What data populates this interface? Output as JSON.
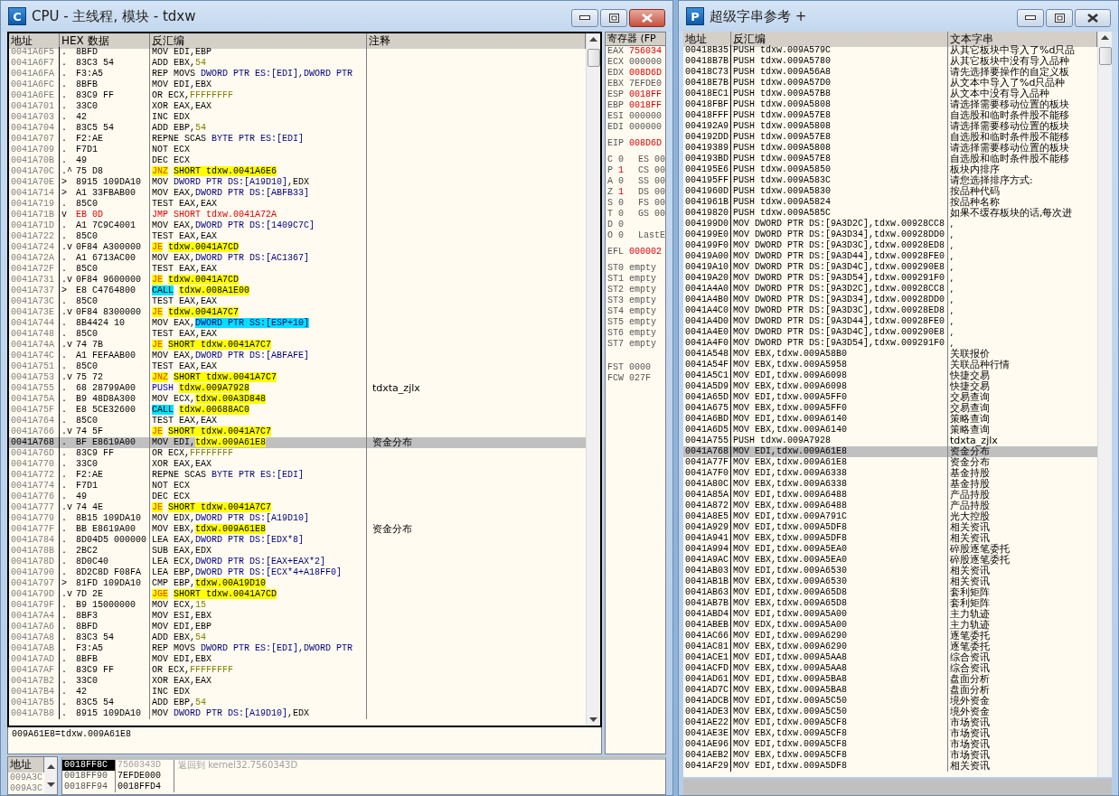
{
  "cpu_window": {
    "title": "CPU - 主线程, 模块 - tdxw",
    "icon_letter": "C",
    "disassembly": {
      "columns": [
        "地址",
        "HEX 数据",
        "反汇编",
        "注释"
      ],
      "rows": [
        {
          "address": "0041A6F5",
          "marker": ".",
          "hex": "8BFD",
          "mnemonic": {
            "text": "MOV",
            "kind": "plain"
          },
          "operands": "EDI,EBP",
          "selected": false
        },
        {
          "address": "0041A6F7",
          "marker": ".",
          "hex": "83C3 54",
          "mnemonic": {
            "text": "ADD",
            "kind": "plain"
          },
          "operands": "EBX,",
          "target": {
            "text": "54",
            "kind": "const"
          },
          "selected": false
        },
        {
          "address": "0041A6FA",
          "marker": ".",
          "hex": "F3:A5",
          "mnemonic": {
            "text": "REP MOVS",
            "kind": "plain"
          },
          "target": {
            "text": "DWORD PTR ES:[EDI],DWORD PTR",
            "kind": "mem"
          },
          "selected": false
        },
        {
          "address": "0041A6FC",
          "marker": ".",
          "hex": "8BFB",
          "mnemonic": {
            "text": "MOV",
            "kind": "plain"
          },
          "operands": "EDI,EBX",
          "selected": false
        },
        {
          "address": "0041A6FE",
          "marker": ".",
          "hex": "83C9 FF",
          "mnemonic": {
            "text": "OR",
            "kind": "plain"
          },
          "operands": "ECX,",
          "target": {
            "text": "FFFFFFFF",
            "kind": "const"
          },
          "selected": false
        },
        {
          "address": "0041A701",
          "marker": ".",
          "hex": "33C0",
          "mnemonic": {
            "text": "XOR",
            "kind": "plain"
          },
          "operands": "EAX,EAX",
          "selected": false
        },
        {
          "address": "0041A703",
          "marker": ".",
          "hex": "42",
          "mnemonic": {
            "text": "INC",
            "kind": "plain"
          },
          "operands": "EDX",
          "selected": false
        },
        {
          "address": "0041A704",
          "marker": ".",
          "hex": "83C5 54",
          "mnemonic": {
            "text": "ADD",
            "kind": "plain"
          },
          "operands": "EBP,",
          "target": {
            "text": "54",
            "kind": "const"
          },
          "selected": false
        },
        {
          "address": "0041A707",
          "marker": ".",
          "hex": "F2:AE",
          "mnemonic": {
            "text": "REPNE SCAS",
            "kind": "plain"
          },
          "target": {
            "text": "BYTE PTR ES:[EDI]",
            "kind": "mem"
          },
          "selected": false
        },
        {
          "address": "0041A709",
          "marker": ".",
          "hex": "F7D1",
          "mnemonic": {
            "text": "NOT",
            "kind": "plain"
          },
          "operands": "ECX",
          "selected": false
        },
        {
          "address": "0041A70B",
          "marker": ".",
          "hex": "49",
          "mnemonic": {
            "text": "DEC",
            "kind": "plain"
          },
          "operands": "ECX",
          "selected": false
        },
        {
          "address": "0041A70C",
          "marker": ".^",
          "hex": "75 D8",
          "mnemonic": {
            "text": "JNZ",
            "kind": "cond_jump"
          },
          "target": {
            "text": "SHORT tdxw.0041A6E6",
            "kind": "addr"
          },
          "selected": false
        },
        {
          "address": "0041A70E",
          "marker": ">",
          "hex": "8915 109DA10",
          "mnemonic": {
            "text": "MOV",
            "kind": "plain"
          },
          "target": {
            "text": "DWORD PTR DS:[A19D10]",
            "kind": "mem"
          },
          "tail": ",EDX",
          "selected": false
        },
        {
          "address": "0041A714",
          "marker": ">",
          "hex": "A1 33FBAB00",
          "mnemonic": {
            "text": "MOV",
            "kind": "plain"
          },
          "operands": "EAX,",
          "target": {
            "text": "DWORD PTR DS:[ABFB33]",
            "kind": "mem"
          },
          "selected": false
        },
        {
          "address": "0041A719",
          "marker": ".",
          "hex": "85C0",
          "mnemonic": {
            "text": "TEST",
            "kind": "plain"
          },
          "operands": "EAX,EAX",
          "selected": false
        },
        {
          "address": "0041A71B",
          "marker": "v",
          "hex": "EB 0D",
          "mnemonic": {
            "text": "JMP",
            "kind": "jump"
          },
          "target": {
            "text": "SHORT tdxw.0041A72A",
            "kind": "red"
          },
          "selected": false
        },
        {
          "address": "0041A71D",
          "marker": ".",
          "hex": "A1 7C9C4001",
          "mnemonic": {
            "text": "MOV",
            "kind": "plain"
          },
          "operands": "EAX,",
          "target": {
            "text": "DWORD PTR DS:[1409C7C]",
            "kind": "mem"
          },
          "selected": false
        },
        {
          "address": "0041A722",
          "marker": ".",
          "hex": "85C0",
          "mnemonic": {
            "text": "TEST",
            "kind": "plain"
          },
          "operands": "EAX,EAX",
          "selected": false
        },
        {
          "address": "0041A724",
          "marker": ".v",
          "hex": "0F84 A300000",
          "mnemonic": {
            "text": "JE",
            "kind": "cond_jump"
          },
          "target": {
            "text": "tdxw.0041A7CD",
            "kind": "addr"
          },
          "selected": false
        },
        {
          "address": "0041A72A",
          "marker": ".",
          "hex": "A1 6713AC00",
          "mnemonic": {
            "text": "MOV",
            "kind": "plain"
          },
          "operands": "EAX,",
          "target": {
            "text": "DWORD PTR DS:[AC1367]",
            "kind": "mem"
          },
          "selected": false
        },
        {
          "address": "0041A72F",
          "marker": ".",
          "hex": "85C0",
          "mnemonic": {
            "text": "TEST",
            "kind": "plain"
          },
          "operands": "EAX,EAX",
          "selected": false
        },
        {
          "address": "0041A731",
          "marker": ".v",
          "hex": "0F84 9600000",
          "mnemonic": {
            "text": "JE",
            "kind": "cond_jump"
          },
          "target": {
            "text": "tdxw.0041A7CD",
            "kind": "addr"
          },
          "selected": false
        },
        {
          "address": "0041A737",
          "marker": ">",
          "hex": "E8 C4764800",
          "mnemonic": {
            "text": "CALL",
            "kind": "call"
          },
          "target": {
            "text": "tdxw.008A1E00",
            "kind": "addr"
          },
          "selected": false
        },
        {
          "address": "0041A73C",
          "marker": ".",
          "hex": "85C0",
          "mnemonic": {
            "text": "TEST",
            "kind": "plain"
          },
          "operands": "EAX,EAX",
          "selected": false
        },
        {
          "address": "0041A73E",
          "marker": ".v",
          "hex": "0F84 8300000",
          "mnemonic": {
            "text": "JE",
            "kind": "cond_jump"
          },
          "target": {
            "text": "tdxw.0041A7C7",
            "kind": "addr"
          },
          "selected": false
        },
        {
          "address": "0041A744",
          "marker": ".",
          "hex": "8B4424 10",
          "mnemonic": {
            "text": "MOV",
            "kind": "plain"
          },
          "operands": "EAX,",
          "target": {
            "text": "DWORD PTR SS:[ESP+10]",
            "kind": "stack"
          },
          "selected": false
        },
        {
          "address": "0041A748",
          "marker": ".",
          "hex": "85C0",
          "mnemonic": {
            "text": "TEST",
            "kind": "plain"
          },
          "operands": "EAX,EAX",
          "selected": false
        },
        {
          "address": "0041A74A",
          "marker": ".v",
          "hex": "74 7B",
          "mnemonic": {
            "text": "JE",
            "kind": "cond_jump"
          },
          "target": {
            "text": "SHORT tdxw.0041A7C7",
            "kind": "addr"
          },
          "selected": false
        },
        {
          "address": "0041A74C",
          "marker": ".",
          "hex": "A1 FEFAAB00",
          "mnemonic": {
            "text": "MOV",
            "kind": "plain"
          },
          "operands": "EAX,",
          "target": {
            "text": "DWORD PTR DS:[ABFAFE]",
            "kind": "mem"
          },
          "selected": false
        },
        {
          "address": "0041A751",
          "marker": ".",
          "hex": "85C0",
          "mnemonic": {
            "text": "TEST",
            "kind": "plain"
          },
          "operands": "EAX,EAX",
          "selected": false
        },
        {
          "address": "0041A753",
          "marker": ".v",
          "hex": "75 72",
          "mnemonic": {
            "text": "JNZ",
            "kind": "cond_jump"
          },
          "target": {
            "text": "SHORT tdxw.0041A7C7",
            "kind": "addr"
          },
          "selected": false
        },
        {
          "address": "0041A755",
          "marker": ".",
          "hex": "68 28799A00",
          "mnemonic": {
            "text": "PUSH",
            "kind": "push"
          },
          "target": {
            "text": "tdxw.009A7928",
            "kind": "addr"
          },
          "comment": "tdxta_zjlx",
          "selected": false
        },
        {
          "address": "0041A75A",
          "marker": ".",
          "hex": "B9 48D8A300",
          "mnemonic": {
            "text": "MOV",
            "kind": "plain"
          },
          "operands": "ECX,",
          "target": {
            "text": "tdxw.00A3D848",
            "kind": "addr"
          },
          "selected": false
        },
        {
          "address": "0041A75F",
          "marker": ".",
          "hex": "E8 5CE32600",
          "mnemonic": {
            "text": "CALL",
            "kind": "call"
          },
          "target": {
            "text": "tdxw.00688AC0",
            "kind": "addr"
          },
          "selected": false
        },
        {
          "address": "0041A764",
          "marker": ".",
          "hex": "85C0",
          "mnemonic": {
            "text": "TEST",
            "kind": "plain"
          },
          "operands": "EAX,EAX",
          "selected": false
        },
        {
          "address": "0041A766",
          "marker": ".v",
          "hex": "74 5F",
          "mnemonic": {
            "text": "JE",
            "kind": "cond_jump"
          },
          "target": {
            "text": "SHORT tdxw.0041A7C7",
            "kind": "addr"
          },
          "selected": false
        },
        {
          "address": "0041A768",
          "marker": ".",
          "hex": "BF E8619A00",
          "mnemonic": {
            "text": "MOV",
            "kind": "plain"
          },
          "operands": "EDI,",
          "target": {
            "text": "tdxw.009A61E8",
            "kind": "addr"
          },
          "comment": "资金分布",
          "selected": true
        },
        {
          "address": "0041A76D",
          "marker": ".",
          "hex": "83C9 FF",
          "mnemonic": {
            "text": "OR",
            "kind": "plain"
          },
          "operands": "ECX,",
          "target": {
            "text": "FFFFFFFF",
            "kind": "const"
          },
          "selected": false
        },
        {
          "address": "0041A770",
          "marker": ".",
          "hex": "33C0",
          "mnemonic": {
            "text": "XOR",
            "kind": "plain"
          },
          "operands": "EAX,EAX",
          "selected": false
        },
        {
          "address": "0041A772",
          "marker": ".",
          "hex": "F2:AE",
          "mnemonic": {
            "text": "REPNE SCAS",
            "kind": "plain"
          },
          "target": {
            "text": "BYTE PTR ES:[EDI]",
            "kind": "mem"
          },
          "selected": false
        },
        {
          "address": "0041A774",
          "marker": ".",
          "hex": "F7D1",
          "mnemonic": {
            "text": "NOT",
            "kind": "plain"
          },
          "operands": "ECX",
          "selected": false
        },
        {
          "address": "0041A776",
          "marker": ".",
          "hex": "49",
          "mnemonic": {
            "text": "DEC",
            "kind": "plain"
          },
          "operands": "ECX",
          "selected": false
        },
        {
          "address": "0041A777",
          "marker": ".v",
          "hex": "74 4E",
          "mnemonic": {
            "text": "JE",
            "kind": "cond_jump"
          },
          "target": {
            "text": "SHORT tdxw.0041A7C7",
            "kind": "addr"
          },
          "selected": false
        },
        {
          "address": "0041A779",
          "marker": ".",
          "hex": "8B15 109DA10",
          "mnemonic": {
            "text": "MOV",
            "kind": "plain"
          },
          "operands": "EDX,",
          "target": {
            "text": "DWORD PTR DS:[A19D10]",
            "kind": "mem"
          },
          "selected": false
        },
        {
          "address": "0041A77F",
          "marker": ".",
          "hex": "BB E8619A00",
          "mnemonic": {
            "text": "MOV",
            "kind": "plain"
          },
          "operands": "EBX,",
          "target": {
            "text": "tdxw.009A61E8",
            "kind": "addr"
          },
          "comment": "资金分布",
          "selected": false
        },
        {
          "address": "0041A784",
          "marker": ".",
          "hex": "8D04D5 000000",
          "mnemonic": {
            "text": "LEA",
            "kind": "plain"
          },
          "operands": "EAX,",
          "target": {
            "text": "DWORD PTR DS:[EDX*8]",
            "kind": "mem"
          },
          "selected": false
        },
        {
          "address": "0041A78B",
          "marker": ".",
          "hex": "2BC2",
          "mnemonic": {
            "text": "SUB",
            "kind": "plain"
          },
          "operands": "EAX,EDX",
          "selected": false
        },
        {
          "address": "0041A78D",
          "marker": ".",
          "hex": "8D0C40",
          "mnemonic": {
            "text": "LEA",
            "kind": "plain"
          },
          "operands": "ECX,",
          "target": {
            "text": "DWORD PTR DS:[EAX+EAX*2]",
            "kind": "mem"
          },
          "selected": false
        },
        {
          "address": "0041A790",
          "marker": ".",
          "hex": "8D2C8D F08FA",
          "mnemonic": {
            "text": "LEA",
            "kind": "plain"
          },
          "operands": "EBP,",
          "target": {
            "text": "DWORD PTR DS:[ECX*4+A18FF0]",
            "kind": "mem"
          },
          "selected": false
        },
        {
          "address": "0041A797",
          "marker": ">",
          "hex": "81FD 109DA10",
          "mnemonic": {
            "text": "CMP",
            "kind": "plain"
          },
          "operands": "EBP,",
          "target": {
            "text": "tdxw.00A19D10",
            "kind": "addr"
          },
          "selected": false
        },
        {
          "address": "0041A79D",
          "marker": ".v",
          "hex": "7D 2E",
          "mnemonic": {
            "text": "JGE",
            "kind": "cond_jump"
          },
          "target": {
            "text": "SHORT tdxw.0041A7CD",
            "kind": "addr"
          },
          "selected": false
        },
        {
          "address": "0041A79F",
          "marker": ".",
          "hex": "B9 15000000",
          "mnemonic": {
            "text": "MOV",
            "kind": "plain"
          },
          "operands": "ECX,",
          "target": {
            "text": "15",
            "kind": "const"
          },
          "selected": false
        },
        {
          "address": "0041A7A4",
          "marker": ".",
          "hex": "8BF3",
          "mnemonic": {
            "text": "MOV",
            "kind": "plain"
          },
          "operands": "ESI,EBX",
          "selected": false
        },
        {
          "address": "0041A7A6",
          "marker": ".",
          "hex": "8BFD",
          "mnemonic": {
            "text": "MOV",
            "kind": "plain"
          },
          "operands": "EDI,EBP",
          "selected": false
        },
        {
          "address": "0041A7A8",
          "marker": ".",
          "hex": "83C3 54",
          "mnemonic": {
            "text": "ADD",
            "kind": "plain"
          },
          "operands": "EBX,",
          "target": {
            "text": "54",
            "kind": "const"
          },
          "selected": false
        },
        {
          "address": "0041A7AB",
          "marker": ".",
          "hex": "F3:A5",
          "mnemonic": {
            "text": "REP MOVS",
            "kind": "plain"
          },
          "target": {
            "text": "DWORD PTR ES:[EDI],DWORD PTR",
            "kind": "mem"
          },
          "selected": false
        },
        {
          "address": "0041A7AD",
          "marker": ".",
          "hex": "8BFB",
          "mnemonic": {
            "text": "MOV",
            "kind": "plain"
          },
          "operands": "EDI,EBX",
          "selected": false
        },
        {
          "address": "0041A7AF",
          "marker": ".",
          "hex": "83C9 FF",
          "mnemonic": {
            "text": "OR",
            "kind": "plain"
          },
          "operands": "ECX,",
          "target": {
            "text": "FFFFFFFF",
            "kind": "const"
          },
          "selected": false
        },
        {
          "address": "0041A7B2",
          "marker": ".",
          "hex": "33C0",
          "mnemonic": {
            "text": "XOR",
            "kind": "plain"
          },
          "operands": "EAX,EAX",
          "selected": false
        },
        {
          "address": "0041A7B4",
          "marker": ".",
          "hex": "42",
          "mnemonic": {
            "text": "INC",
            "kind": "plain"
          },
          "operands": "EDX",
          "selected": false
        },
        {
          "address": "0041A7B5",
          "marker": ".",
          "hex": "83C5 54",
          "mnemonic": {
            "text": "ADD",
            "kind": "plain"
          },
          "operands": "EBP,",
          "target": {
            "text": "54",
            "kind": "const"
          },
          "selected": false
        },
        {
          "address": "0041A7B8",
          "marker": ".",
          "hex": "8915 109DA10",
          "mnemonic": {
            "text": "MOV",
            "kind": "plain"
          },
          "target": {
            "text": "DWORD PTR DS:[A19D10]",
            "kind": "mem"
          },
          "tail": ",EDX",
          "selected": false
        }
      ]
    },
    "registers": {
      "header": "寄存器 (FP",
      "registers": [
        {
          "name": "EAX",
          "value": "756034",
          "changed": true
        },
        {
          "name": "ECX",
          "value": "000000",
          "changed": false
        },
        {
          "name": "EDX",
          "value": "008D6D",
          "changed": true
        },
        {
          "name": "EBX",
          "value": "7EFDE0",
          "changed": false
        },
        {
          "name": "ESP",
          "value": "0018FF",
          "changed": true
        },
        {
          "name": "EBP",
          "value": "0018FF",
          "changed": true
        },
        {
          "name": "ESI",
          "value": "000000",
          "changed": false
        },
        {
          "name": "EDI",
          "value": "000000",
          "changed": false
        }
      ],
      "eip": {
        "name": "EIP",
        "value": "008D6D",
        "changed": true
      },
      "flags": [
        {
          "flag": "C",
          "value": "0",
          "changed": false,
          "right": "ES 00"
        },
        {
          "flag": "P",
          "value": "1",
          "changed": true,
          "right": "CS 00"
        },
        {
          "flag": "A",
          "value": "0",
          "changed": false,
          "right": "SS 00"
        },
        {
          "flag": "Z",
          "value": "1",
          "changed": true,
          "right": "DS 00"
        },
        {
          "flag": "S",
          "value": "0",
          "changed": false,
          "right": "FS 00"
        },
        {
          "flag": "T",
          "value": "0",
          "changed": false,
          "right": "GS 00"
        },
        {
          "flag": "D",
          "value": "0",
          "changed": false
        },
        {
          "flag": "O",
          "value": "0",
          "changed": false,
          "right": "LastE"
        }
      ],
      "efl": {
        "name": "EFL",
        "value": "000002",
        "changed": true
      },
      "fpu": [
        {
          "name": "ST0",
          "value": "empty"
        },
        {
          "name": "ST1",
          "value": "empty"
        },
        {
          "name": "ST2",
          "value": "empty"
        },
        {
          "name": "ST3",
          "value": "empty"
        },
        {
          "name": "ST4",
          "value": "empty"
        },
        {
          "name": "ST5",
          "value": "empty"
        },
        {
          "name": "ST6",
          "value": "empty"
        },
        {
          "name": "ST7",
          "value": "empty"
        }
      ],
      "fpu_control": [
        {
          "name": "FST",
          "value": "0000"
        },
        {
          "name": "FCW",
          "value": "027F"
        }
      ]
    },
    "info_line": "009A61E8=tdxw.009A61E8",
    "dump": {
      "column": "地址",
      "rows": [
        "009A3C",
        "009A3C"
      ]
    },
    "stack": {
      "rows": [
        {
          "address": "0018FF8C",
          "value": "7560343D",
          "comment": "返回到 kernel32.7560343D",
          "selected": true
        },
        {
          "address": "0018FF90",
          "value": "7EFDE000",
          "selected": false
        },
        {
          "address": "0018FF94",
          "value": "0018FFD4",
          "selected": false
        }
      ]
    }
  },
  "strings_window": {
    "title": "超级字串参考 +",
    "icon_letter": "P",
    "columns": [
      "地址",
      "反汇编",
      "文本字串"
    ],
    "rows": [
      {
        "address": "00418B35",
        "disassembly": "PUSH tdxw.009A579C",
        "text": "从其它板块中导入了%d只品",
        "selected": false
      },
      {
        "address": "00418B7B",
        "disassembly": "PUSH tdxw.009A5780",
        "text": "从其它板块中没有导入品种",
        "selected": false
      },
      {
        "address": "00418C73",
        "disassembly": "PUSH tdxw.009A56A8",
        "text": "请先选择要操作的自定义板",
        "selected": false
      },
      {
        "address": "00418E7B",
        "disassembly": "PUSH tdxw.009A57D0",
        "text": "从文本中导入了%d只品种",
        "selected": false
      },
      {
        "address": "00418EC1",
        "disassembly": "PUSH tdxw.009A57B8",
        "text": "从文本中没有导入品种",
        "selected": false
      },
      {
        "address": "00418FBF",
        "disassembly": "PUSH tdxw.009A5808",
        "text": "请选择需要移动位置的板块",
        "selected": false
      },
      {
        "address": "00418FFF",
        "disassembly": "PUSH tdxw.009A57E8",
        "text": "自选股和临时条件股不能移",
        "selected": false
      },
      {
        "address": "004192A9",
        "disassembly": "PUSH tdxw.009A5808",
        "text": "请选择需要移动位置的板块",
        "selected": false
      },
      {
        "address": "004192DD",
        "disassembly": "PUSH tdxw.009A57E8",
        "text": "自选股和临时条件股不能移",
        "selected": false
      },
      {
        "address": "00419389",
        "disassembly": "PUSH tdxw.009A5808",
        "text": "请选择需要移动位置的板块",
        "selected": false
      },
      {
        "address": "004193BD",
        "disassembly": "PUSH tdxw.009A57E8",
        "text": "自选股和临时条件股不能移",
        "selected": false
      },
      {
        "address": "004195E6",
        "disassembly": "PUSH tdxw.009A5850",
        "text": "板块内排序",
        "selected": false
      },
      {
        "address": "004195FF",
        "disassembly": "PUSH tdxw.009A583C",
        "text": "请您选择排序方式:",
        "selected": false
      },
      {
        "address": "0041960D",
        "disassembly": "PUSH tdxw.009A5830",
        "text": "按品种代码",
        "selected": false
      },
      {
        "address": "0041961B",
        "disassembly": "PUSH tdxw.009A5824",
        "text": "按品种名称",
        "selected": false
      },
      {
        "address": "00419820",
        "disassembly": "PUSH tdxw.009A585C",
        "text": "如果不缓存板块的话,每次进",
        "selected": false
      },
      {
        "address": "004199D0",
        "disassembly": "MOV DWORD PTR DS:[9A3D2C],tdxw.00928CC8",
        "text": ",",
        "selected": false
      },
      {
        "address": "004199E0",
        "disassembly": "MOV DWORD PTR DS:[9A3D34],tdxw.00928DD0",
        "text": ",",
        "selected": false
      },
      {
        "address": "004199F0",
        "disassembly": "MOV DWORD PTR DS:[9A3D3C],tdxw.00928ED8",
        "text": ",",
        "selected": false
      },
      {
        "address": "00419A00",
        "disassembly": "MOV DWORD PTR DS:[9A3D44],tdxw.00928FE0",
        "text": ",",
        "selected": false
      },
      {
        "address": "00419A10",
        "disassembly": "MOV DWORD PTR DS:[9A3D4C],tdxw.009290E8",
        "text": ",",
        "selected": false
      },
      {
        "address": "00419A20",
        "disassembly": "MOV DWORD PTR DS:[9A3D54],tdxw.009291F0",
        "text": ",",
        "selected": false
      },
      {
        "address": "0041A4A0",
        "disassembly": "MOV DWORD PTR DS:[9A3D2C],tdxw.00928CC8",
        "text": ",",
        "selected": false
      },
      {
        "address": "0041A4B0",
        "disassembly": "MOV DWORD PTR DS:[9A3D34],tdxw.00928DD0",
        "text": ",",
        "selected": false
      },
      {
        "address": "0041A4C0",
        "disassembly": "MOV DWORD PTR DS:[9A3D3C],tdxw.00928ED8",
        "text": ",",
        "selected": false
      },
      {
        "address": "0041A4D0",
        "disassembly": "MOV DWORD PTR DS:[9A3D44],tdxw.00928FE0",
        "text": ",",
        "selected": false
      },
      {
        "address": "0041A4E0",
        "disassembly": "MOV DWORD PTR DS:[9A3D4C],tdxw.009290E8",
        "text": ",",
        "selected": false
      },
      {
        "address": "0041A4F0",
        "disassembly": "MOV DWORD PTR DS:[9A3D54],tdxw.009291F0",
        "text": ",",
        "selected": false
      },
      {
        "address": "0041A548",
        "disassembly": "MOV EBX,tdxw.009A58B0",
        "text": "关联报价",
        "selected": false
      },
      {
        "address": "0041A54F",
        "disassembly": "MOV EBX,tdxw.009A5958",
        "text": "关联品种行情",
        "selected": false
      },
      {
        "address": "0041A5C1",
        "disassembly": "MOV EDI,tdxw.009A6098",
        "text": "快捷交易",
        "selected": false
      },
      {
        "address": "0041A5D9",
        "disassembly": "MOV EBX,tdxw.009A6098",
        "text": "快捷交易",
        "selected": false
      },
      {
        "address": "0041A65D",
        "disassembly": "MOV EDI,tdxw.009A5FF0",
        "text": "交易查询",
        "selected": false
      },
      {
        "address": "0041A675",
        "disassembly": "MOV EBX,tdxw.009A5FF0",
        "text": "交易查询",
        "selected": false
      },
      {
        "address": "0041A6BD",
        "disassembly": "MOV EDI,tdxw.009A6140",
        "text": "策略查询",
        "selected": false
      },
      {
        "address": "0041A6D5",
        "disassembly": "MOV EBX,tdxw.009A6140",
        "text": "策略查询",
        "selected": false
      },
      {
        "address": "0041A755",
        "disassembly": "PUSH tdxw.009A7928",
        "text": "tdxta_zjlx",
        "selected": false
      },
      {
        "address": "0041A768",
        "disassembly": "MOV EDI,tdxw.009A61E8",
        "text": "资金分布",
        "selected": true
      },
      {
        "address": "0041A77F",
        "disassembly": "MOV EBX,tdxw.009A61E8",
        "text": "资金分布",
        "selected": false
      },
      {
        "address": "0041A7F0",
        "disassembly": "MOV EDI,tdxw.009A6338",
        "text": "基金持股",
        "selected": false
      },
      {
        "address": "0041A80C",
        "disassembly": "MOV EBX,tdxw.009A6338",
        "text": "基金持股",
        "selected": false
      },
      {
        "address": "0041A85A",
        "disassembly": "MOV EDI,tdxw.009A6488",
        "text": "产品持股",
        "selected": false
      },
      {
        "address": "0041A872",
        "disassembly": "MOV EBX,tdxw.009A6488",
        "text": "产品持股",
        "selected": false
      },
      {
        "address": "0041A8E5",
        "disassembly": "MOV EDI,tdxw.009A791C",
        "text": "光大控股",
        "selected": false
      },
      {
        "address": "0041A929",
        "disassembly": "MOV EDI,tdxw.009A5DF8",
        "text": "相关资讯",
        "selected": false
      },
      {
        "address": "0041A941",
        "disassembly": "MOV EBX,tdxw.009A5DF8",
        "text": "相关资讯",
        "selected": false
      },
      {
        "address": "0041A994",
        "disassembly": "MOV EDI,tdxw.009A5EA0",
        "text": "碎股逐笔委托",
        "selected": false
      },
      {
        "address": "0041A9AC",
        "disassembly": "MOV EBX,tdxw.009A5EA0",
        "text": "碎股逐笔委托",
        "selected": false
      },
      {
        "address": "0041AB03",
        "disassembly": "MOV EDI,tdxw.009A6530",
        "text": "相关资讯",
        "selected": false
      },
      {
        "address": "0041AB1B",
        "disassembly": "MOV EBX,tdxw.009A6530",
        "text": "相关资讯",
        "selected": false
      },
      {
        "address": "0041AB63",
        "disassembly": "MOV EDI,tdxw.009A65D8",
        "text": "套利矩阵",
        "selected": false
      },
      {
        "address": "0041AB7B",
        "disassembly": "MOV EBX,tdxw.009A65D8",
        "text": "套利矩阵",
        "selected": false
      },
      {
        "address": "0041ABD4",
        "disassembly": "MOV EDI,tdxw.009A5A00",
        "text": "主力轨迹",
        "selected": false
      },
      {
        "address": "0041ABEB",
        "disassembly": "MOV EDX,tdxw.009A5A00",
        "text": "主力轨迹",
        "selected": false
      },
      {
        "address": "0041AC66",
        "disassembly": "MOV EDI,tdxw.009A6290",
        "text": "逐笔委托",
        "selected": false
      },
      {
        "address": "0041AC81",
        "disassembly": "MOV EBX,tdxw.009A6290",
        "text": "逐笔委托",
        "selected": false
      },
      {
        "address": "0041ACE1",
        "disassembly": "MOV EDI,tdxw.009A5AA8",
        "text": "综合资讯",
        "selected": false
      },
      {
        "address": "0041ACFD",
        "disassembly": "MOV EBX,tdxw.009A5AA8",
        "text": "综合资讯",
        "selected": false
      },
      {
        "address": "0041AD61",
        "disassembly": "MOV EDI,tdxw.009A5BA8",
        "text": "盘面分析",
        "selected": false
      },
      {
        "address": "0041AD7C",
        "disassembly": "MOV EBX,tdxw.009A5BA8",
        "text": "盘面分析",
        "selected": false
      },
      {
        "address": "0041ADCB",
        "disassembly": "MOV EDI,tdxw.009A5C50",
        "text": "境外资金",
        "selected": false
      },
      {
        "address": "0041ADE3",
        "disassembly": "MOV EBX,tdxw.009A5C50",
        "text": "境外资金",
        "selected": false
      },
      {
        "address": "0041AE22",
        "disassembly": "MOV EDI,tdxw.009A5CF8",
        "text": "市场资讯",
        "selected": false
      },
      {
        "address": "0041AE3E",
        "disassembly": "MOV EBX,tdxw.009A5CF8",
        "text": "市场资讯",
        "selected": false
      },
      {
        "address": "0041AE96",
        "disassembly": "MOV EDI,tdxw.009A5CF8",
        "text": "市场资讯",
        "selected": false
      },
      {
        "address": "0041AEB2",
        "disassembly": "MOV EBX,tdxw.009A5CF8",
        "text": "市场资讯",
        "selected": false
      },
      {
        "address": "0041AF29",
        "disassembly": "MOV EDI,tdxw.009A5DF8",
        "text": "相关资讯",
        "selected": false
      }
    ]
  }
}
